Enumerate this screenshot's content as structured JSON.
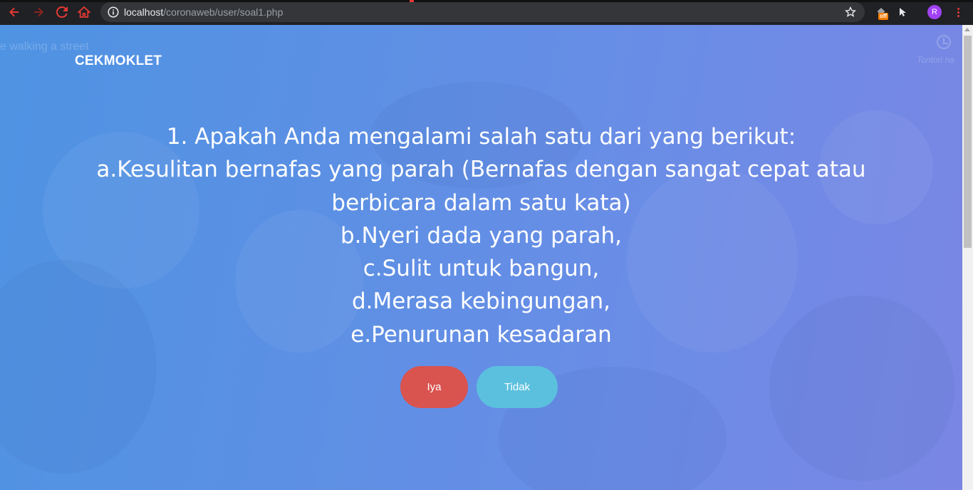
{
  "browser": {
    "url_host": "localhost",
    "url_path": "/coronaweb/user/soal1.php",
    "extension_badge": "off",
    "profile_initial": "R"
  },
  "background": {
    "ghost_text": "e walking a street",
    "ghost_label": "Tonton na"
  },
  "navbar": {
    "brand": "CEKMOKLET"
  },
  "question": {
    "lines": [
      "1. Apakah Anda mengalami salah satu dari yang berikut:",
      "a.Kesulitan bernafas yang parah (Bernafas dengan sangat cepat atau",
      "berbicara dalam satu kata)",
      "b.Nyeri dada yang parah,",
      "c.Sulit untuk bangun,",
      "d.Merasa kebingungan,",
      "e.Penurunan kesadaran"
    ]
  },
  "actions": {
    "yes_label": "Iya",
    "no_label": "Tidak"
  },
  "colors": {
    "yes_button": "#d9534f",
    "no_button": "#5bc0de",
    "page_gradient_start": "#4f93e3",
    "page_gradient_end": "#7a86e4"
  }
}
